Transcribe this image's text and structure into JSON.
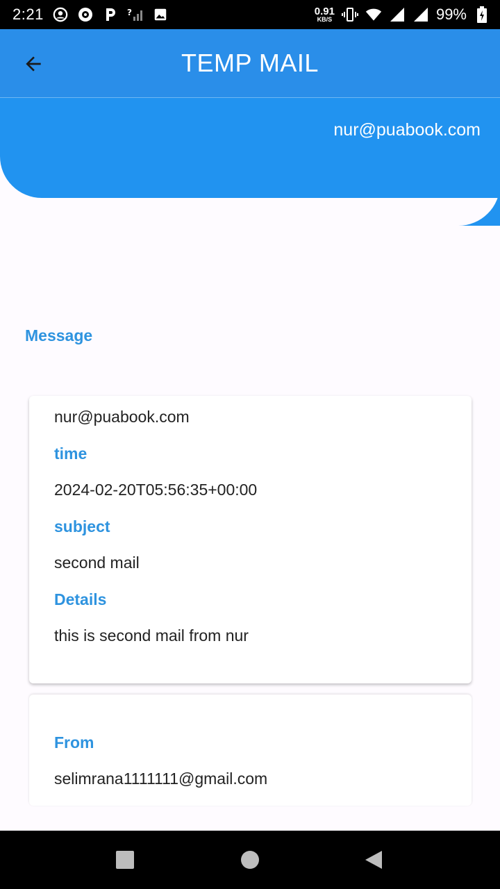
{
  "status_bar": {
    "time": "2:21",
    "net_speed": "0.91",
    "net_unit": "KB/S",
    "battery": "99%",
    "icons": [
      "account-circle-icon",
      "sync-badge-icon",
      "parking-p-icon",
      "no-signal-icon",
      "image-icon",
      "vibrate-icon",
      "wifi-icon",
      "cell-signal-icon",
      "cell-signal-2-icon",
      "battery-icon"
    ]
  },
  "app_bar": {
    "title": "TEMP MAIL",
    "back_icon": "arrow-back-icon"
  },
  "hero": {
    "email": "nur@puabook.com"
  },
  "section": {
    "title": "Message"
  },
  "message_card": {
    "email": "nur@puabook.com",
    "time_label": "time",
    "time_value": "2024-02-20T05:56:35+00:00",
    "subject_label": "subject",
    "subject_value": "second mail",
    "details_label": "Details",
    "details_value": "this is second mail from nur"
  },
  "from_card": {
    "from_label": "From",
    "from_value": "selimrana1111111@gmail.com"
  },
  "nav": {
    "icons": [
      "recents-square-icon",
      "home-circle-icon",
      "back-triangle-icon"
    ]
  },
  "colors": {
    "app_bar": "#2a8ee9",
    "hero": "#2193f0",
    "accent_text": "#2e93df",
    "background": "#fefbff"
  }
}
